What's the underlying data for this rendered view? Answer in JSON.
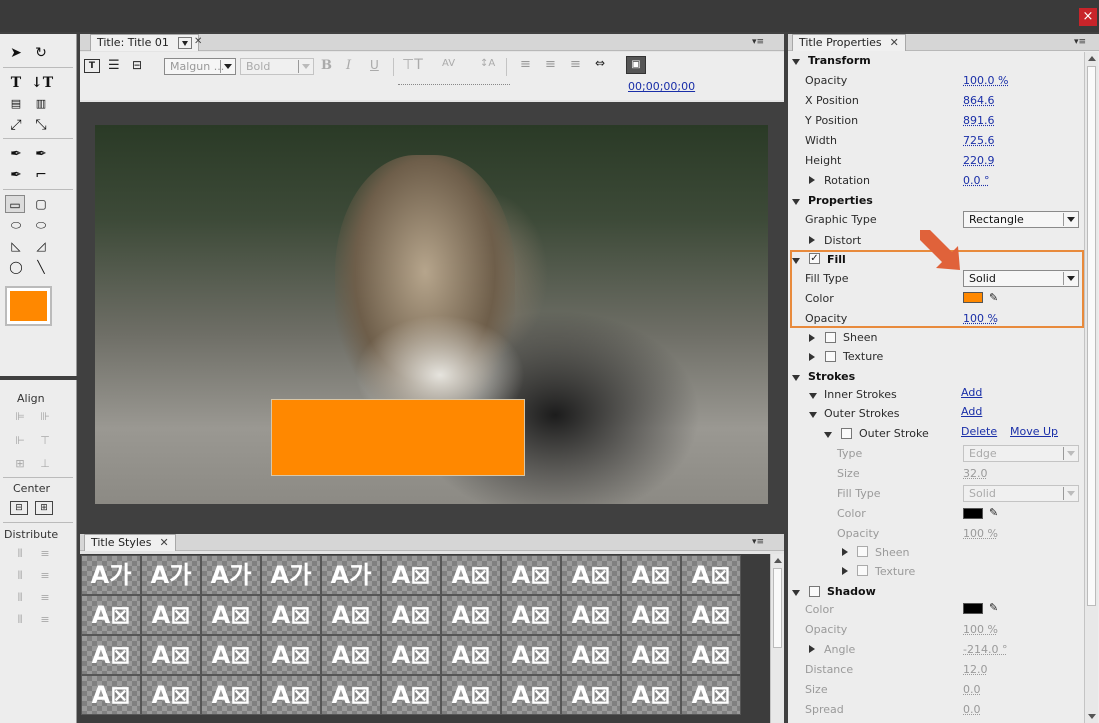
{
  "window": {
    "close_glyph": "×",
    "close_color": "#c8242a"
  },
  "tools": {
    "align_label": "Align",
    "center_label": "Center",
    "distribute_label": "Distribute",
    "fill_swatch_color": "#ff8800"
  },
  "title_panel": {
    "tab_label": "Title: Title 01",
    "font_family": "Malgun ...",
    "font_style": "Bold",
    "timecode": "00;00;00;00",
    "rect_color": "#ff8800"
  },
  "styles_panel": {
    "tab_label": "Title Styles",
    "rows": [
      [
        "A가",
        "A가",
        "A가",
        "A가",
        "A가",
        "A⊠",
        "A⊠",
        "A⊠",
        "A⊠",
        "A⊠",
        "A⊠"
      ],
      [
        "A⊠",
        "A⊠",
        "A⊠",
        "A⊠",
        "A⊠",
        "A⊠",
        "A⊠",
        "A⊠",
        "A⊠",
        "A⊠",
        "A⊠"
      ],
      [
        "A⊠",
        "A⊠",
        "A⊠",
        "A⊠",
        "A⊠",
        "A⊠",
        "A⊠",
        "A⊠",
        "A⊠",
        "A⊠",
        "A⊠"
      ],
      [
        "A⊠",
        "A⊠",
        "A⊠",
        "A⊠",
        "A⊠",
        "A⊠",
        "A⊠",
        "A⊠",
        "A⊠",
        "A⊠",
        "A⊠"
      ]
    ]
  },
  "props_panel": {
    "tab_label": "Title Properties",
    "transform": {
      "header": "Transform",
      "opacity_label": "Opacity",
      "opacity_value": "100.0 %",
      "xpos_label": "X Position",
      "xpos_value": "864.6",
      "ypos_label": "Y Position",
      "ypos_value": "891.6",
      "width_label": "Width",
      "width_value": "725.6",
      "height_label": "Height",
      "height_value": "220.9",
      "rotation_label": "Rotation",
      "rotation_value": "0.0 °"
    },
    "properties": {
      "header": "Properties",
      "graphic_type_label": "Graphic Type",
      "graphic_type_value": "Rectangle",
      "distort_label": "Distort"
    },
    "fill": {
      "header": "Fill",
      "fill_type_label": "Fill Type",
      "fill_type_value": "Solid",
      "color_label": "Color",
      "color_value": "#ff8800",
      "opacity_label": "Opacity",
      "opacity_value": "100 %",
      "sheen_label": "Sheen",
      "texture_label": "Texture"
    },
    "strokes": {
      "header": "Strokes",
      "inner_label": "Inner Strokes",
      "inner_add": "Add",
      "outer_label": "Outer Strokes",
      "outer_add": "Add",
      "outer_stroke_label": "Outer Stroke",
      "delete": "Delete",
      "move_up": "Move Up",
      "type_label": "Type",
      "type_value": "Edge",
      "size_label": "Size",
      "size_value": "32.0",
      "filltype_label": "Fill Type",
      "filltype_value": "Solid",
      "color_label": "Color",
      "color_value": "#000000",
      "opacity_label": "Opacity",
      "opacity_value": "100 %",
      "sheen_label": "Sheen",
      "texture_label": "Texture"
    },
    "shadow": {
      "header": "Shadow",
      "color_label": "Color",
      "color_value": "#000000",
      "opacity_label": "Opacity",
      "opacity_value": "100 %",
      "angle_label": "Angle",
      "angle_value": "-214.0 °",
      "distance_label": "Distance",
      "distance_value": "12.0",
      "size_label": "Size",
      "size_value": "0.0",
      "spread_label": "Spread",
      "spread_value": "0.0"
    },
    "highlight_color": "#e88a3c",
    "arrow_color": "#e0623a"
  }
}
